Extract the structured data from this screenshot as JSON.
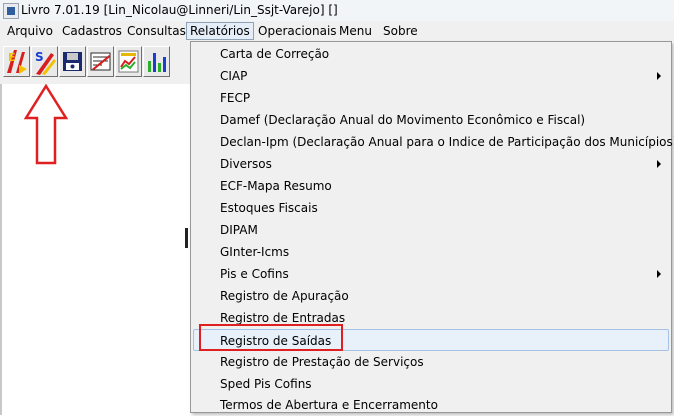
{
  "window": {
    "title": "Livro 7.01.19  [Lin_Nicolau@Linneri/Lin_Ssjt-Varejo] []"
  },
  "menubar": {
    "items": [
      {
        "label": "Arquivo"
      },
      {
        "label": "Cadastros"
      },
      {
        "label": "Consultas"
      },
      {
        "label": "Relatórios",
        "active": true
      },
      {
        "label": "Operacionais"
      },
      {
        "label": "Menu"
      },
      {
        "label": "Sobre"
      }
    ]
  },
  "toolbar": {
    "buttons": [
      {
        "icon": "entradas-icon",
        "colors": [
          "#d81e1e",
          "#f2c200"
        ]
      },
      {
        "icon": "saidas-icon",
        "colors": [
          "#1a3fd0",
          "#d81e1e",
          "#f2c200"
        ]
      },
      {
        "icon": "save-disk-icon",
        "colors": [
          "#1b2a6e",
          "#c9c9c9"
        ]
      },
      {
        "icon": "report-icon",
        "colors": [
          "#2b2b2b",
          "#d81e1e"
        ]
      },
      {
        "icon": "chart-icon",
        "colors": [
          "#d81e1e",
          "#2bb02b",
          "#e6b800"
        ]
      },
      {
        "icon": "bars-icon",
        "colors": [
          "#2bb02b",
          "#1a3fd0"
        ]
      }
    ]
  },
  "relatorios_menu": {
    "items": [
      {
        "label": "Carta de Correção",
        "submenu": false
      },
      {
        "label": "CIAP",
        "submenu": true
      },
      {
        "label": "FECP",
        "submenu": false
      },
      {
        "label": "Damef (Declaração Anual do Movimento Econômico e Fiscal)",
        "submenu": false
      },
      {
        "label": "Declan-Ipm (Declaração Anual para o Indice de Participação dos Municípios)",
        "submenu": false
      },
      {
        "label": "Diversos",
        "submenu": true
      },
      {
        "label": "ECF-Mapa Resumo",
        "submenu": false
      },
      {
        "label": "Estoques Fiscais",
        "submenu": false
      },
      {
        "label": "DIPAM",
        "submenu": false
      },
      {
        "label": "GInter-Icms",
        "submenu": false
      },
      {
        "label": "Pis e Cofins",
        "submenu": true
      },
      {
        "label": "Registro de Apuração",
        "submenu": false
      },
      {
        "label": "Registro de Entradas",
        "submenu": false
      },
      {
        "label": "Registro de Saídas",
        "submenu": false,
        "highlighted": true
      },
      {
        "label": "Registro de Prestação de Serviços",
        "submenu": false
      },
      {
        "label": "Sped Pis Cofins",
        "submenu": false
      },
      {
        "label": "Termos de Abertura e Encerramento",
        "submenu": false
      }
    ]
  },
  "annotations": {
    "arrow_color": "#e02020",
    "box_color": "#e02020"
  }
}
